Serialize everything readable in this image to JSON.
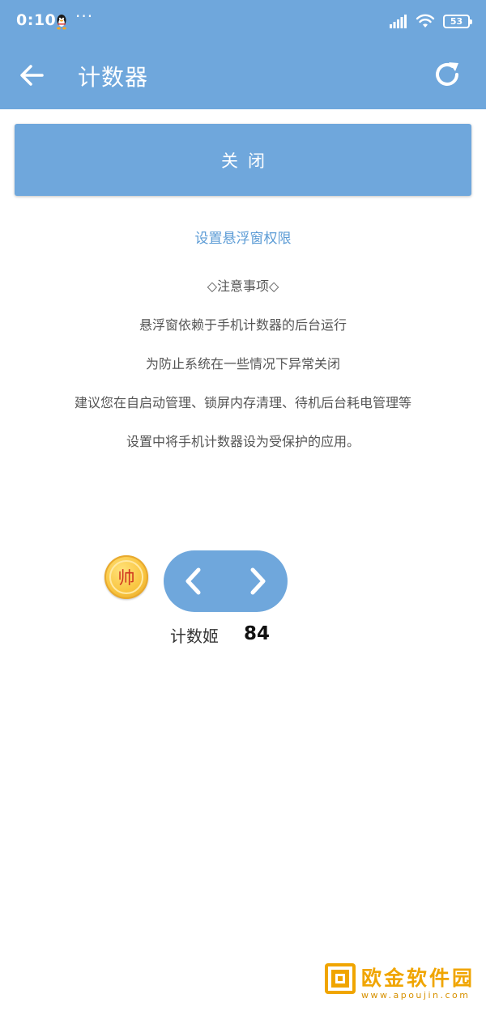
{
  "status_bar": {
    "time": "0:10",
    "more": "···",
    "battery": "53",
    "icons": [
      "qq-penguin-icon",
      "signal-icon",
      "wifi-icon",
      "battery-icon"
    ]
  },
  "app_bar": {
    "title": "计数器",
    "back_icon": "arrow-left-icon",
    "refresh_icon": "refresh-icon",
    "background": "#6fa7dc"
  },
  "main": {
    "close_label": "关闭",
    "permission_link": "设置悬浮窗权限",
    "notes_title": "◇注意事项◇",
    "notes": [
      "悬浮窗依赖于手机计数器的后台运行",
      "为防止系统在一些情况下异常关闭",
      "建议您在自启动管理、锁屏内存清理、待机后台耗电管理等",
      "设置中将手机计数器设为受保护的应用。"
    ]
  },
  "widget": {
    "coin_char": "帅",
    "prev_icon": "chevron-left-icon",
    "next_icon": "chevron-right-icon",
    "counter_label": "计数姬",
    "counter_value": "84"
  },
  "watermark": {
    "text": "欧金软件园",
    "url": "www.apoujin.com"
  },
  "colors": {
    "accent": "#6fa7dc",
    "link": "#5b9bd5",
    "watermark": "#f0a500"
  }
}
